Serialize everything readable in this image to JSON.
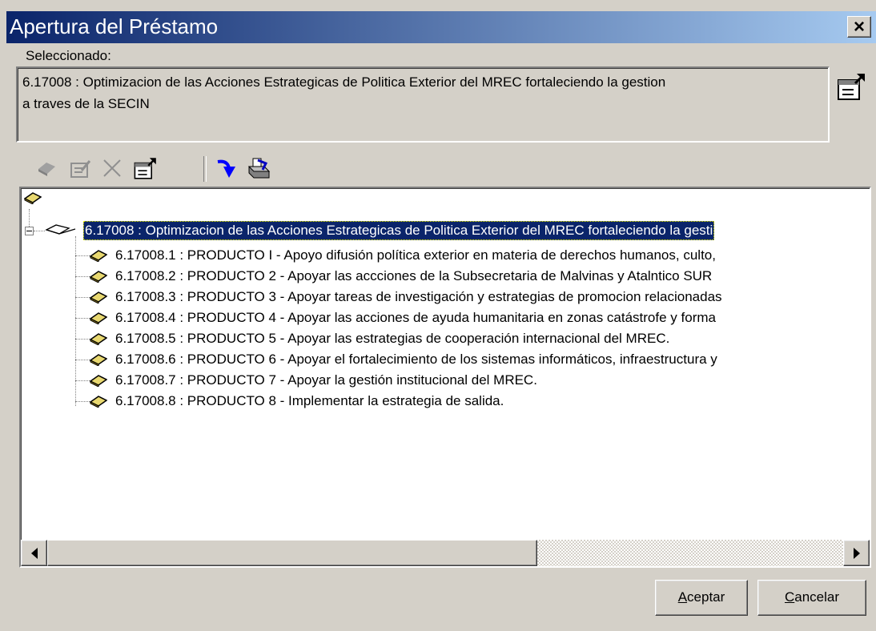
{
  "window": {
    "title": "Apertura del Préstamo",
    "close_label": "×"
  },
  "selected": {
    "label": "Seleccionado:",
    "line1": "6.17008 : Optimizacion de las Acciones Estrategicas de Politica Exterior del MREC fortaleciendo la gestion",
    "line2": "a traves de la SECIN"
  },
  "toolbar": {
    "icons": [
      "add-icon",
      "edit-icon",
      "delete-icon",
      "properties-icon",
      "move-down-icon",
      "print-icon"
    ]
  },
  "tree": {
    "root_node": "6.17008 : Optimizacion de las Acciones Estrategicas de Politica Exterior del MREC fortaleciendo la gesti",
    "children": [
      "6.17008.1 : PRODUCTO I - Apoyo difusión política exterior en materia de derechos humanos, culto,",
      "6.17008.2 : PRODUCTO 2 - Apoyar las accciones de la Subsecretaria de Malvinas y Atalntico SUR",
      "6.17008.3 : PRODUCTO 3 - Apoyar tareas de investigación y estrategias de promocion relacionadas",
      "6.17008.4 : PRODUCTO 4 - Apoyar las acciones de ayuda humanitaria en zonas catástrofe y  forma",
      "6.17008.5 : PRODUCTO 5 - Apoyar las estrategias de cooperación internacional del MREC.",
      "6.17008.6 : PRODUCTO 6 - Apoyar el fortalecimiento de los sistemas informáticos, infraestructura y",
      "6.17008.7 : PRODUCTO 7 - Apoyar la gestión institucional del MREC.",
      "6.17008.8 : PRODUCTO 8 - Implementar la estrategia de salida."
    ]
  },
  "buttons": {
    "accept_first": "A",
    "accept_rest": "ceptar",
    "cancel_first": "C",
    "cancel_rest": "ancelar"
  }
}
